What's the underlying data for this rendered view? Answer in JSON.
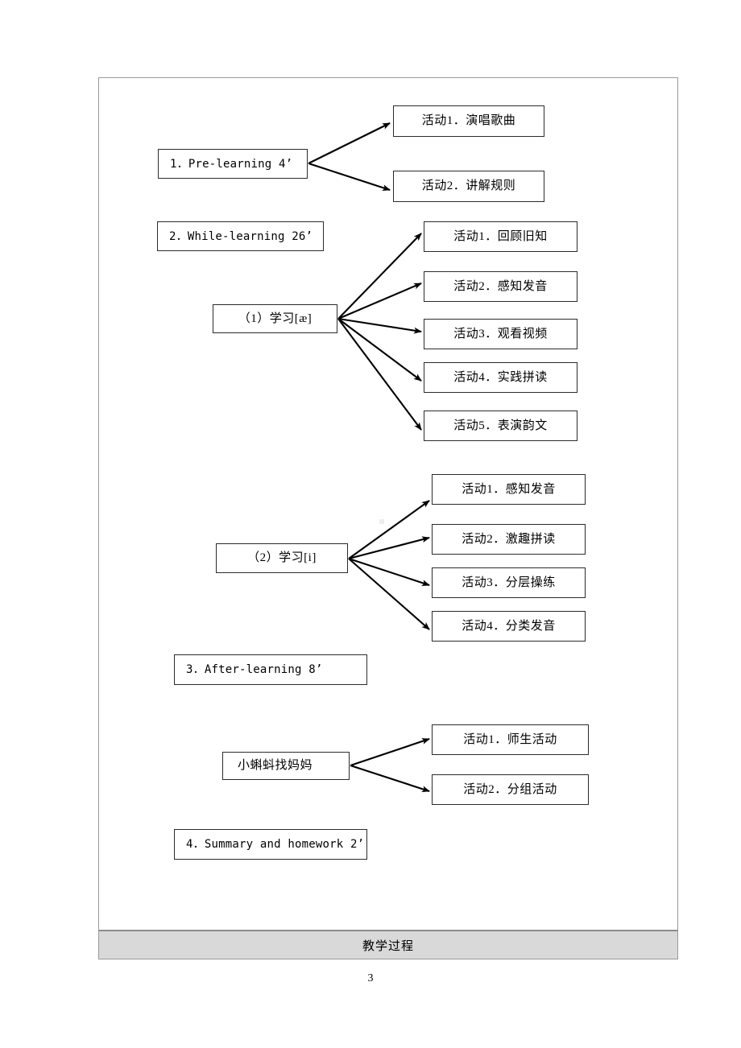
{
  "document": {
    "page_number": "3",
    "footer_label": "教学过程"
  },
  "diagram": {
    "type": "flowchart",
    "stages": [
      {
        "id": "pre-learning",
        "label": "1．Pre-learning 4’",
        "activities": [
          "活动1．演唱歌曲",
          "活动2．讲解规则"
        ]
      },
      {
        "id": "while-learning",
        "label": "2．While-learning 26’",
        "activities": []
      },
      {
        "id": "study-ae",
        "label": "（1）学习[æ]",
        "activities": [
          "活动1．回顾旧知",
          "活动2．感知发音",
          "活动3．观看视频",
          "活动4．实践拼读",
          "活动5．表演韵文"
        ]
      },
      {
        "id": "study-i",
        "label": "（2）学习[i]",
        "activities": [
          "活动1．感知发音",
          "活动2．激趣拼读",
          "活动3．分层操练",
          "活动4．分类发音"
        ]
      },
      {
        "id": "after-learning",
        "label": "3．After-learning  8’",
        "activities": []
      },
      {
        "id": "tadpole-game",
        "label": "小蝌蚪找妈妈",
        "activities": [
          "活动1．师生活动",
          "活动2．分组活动"
        ]
      },
      {
        "id": "summary-homework",
        "label": "4．Summary and homework 2’",
        "activities": []
      }
    ]
  }
}
